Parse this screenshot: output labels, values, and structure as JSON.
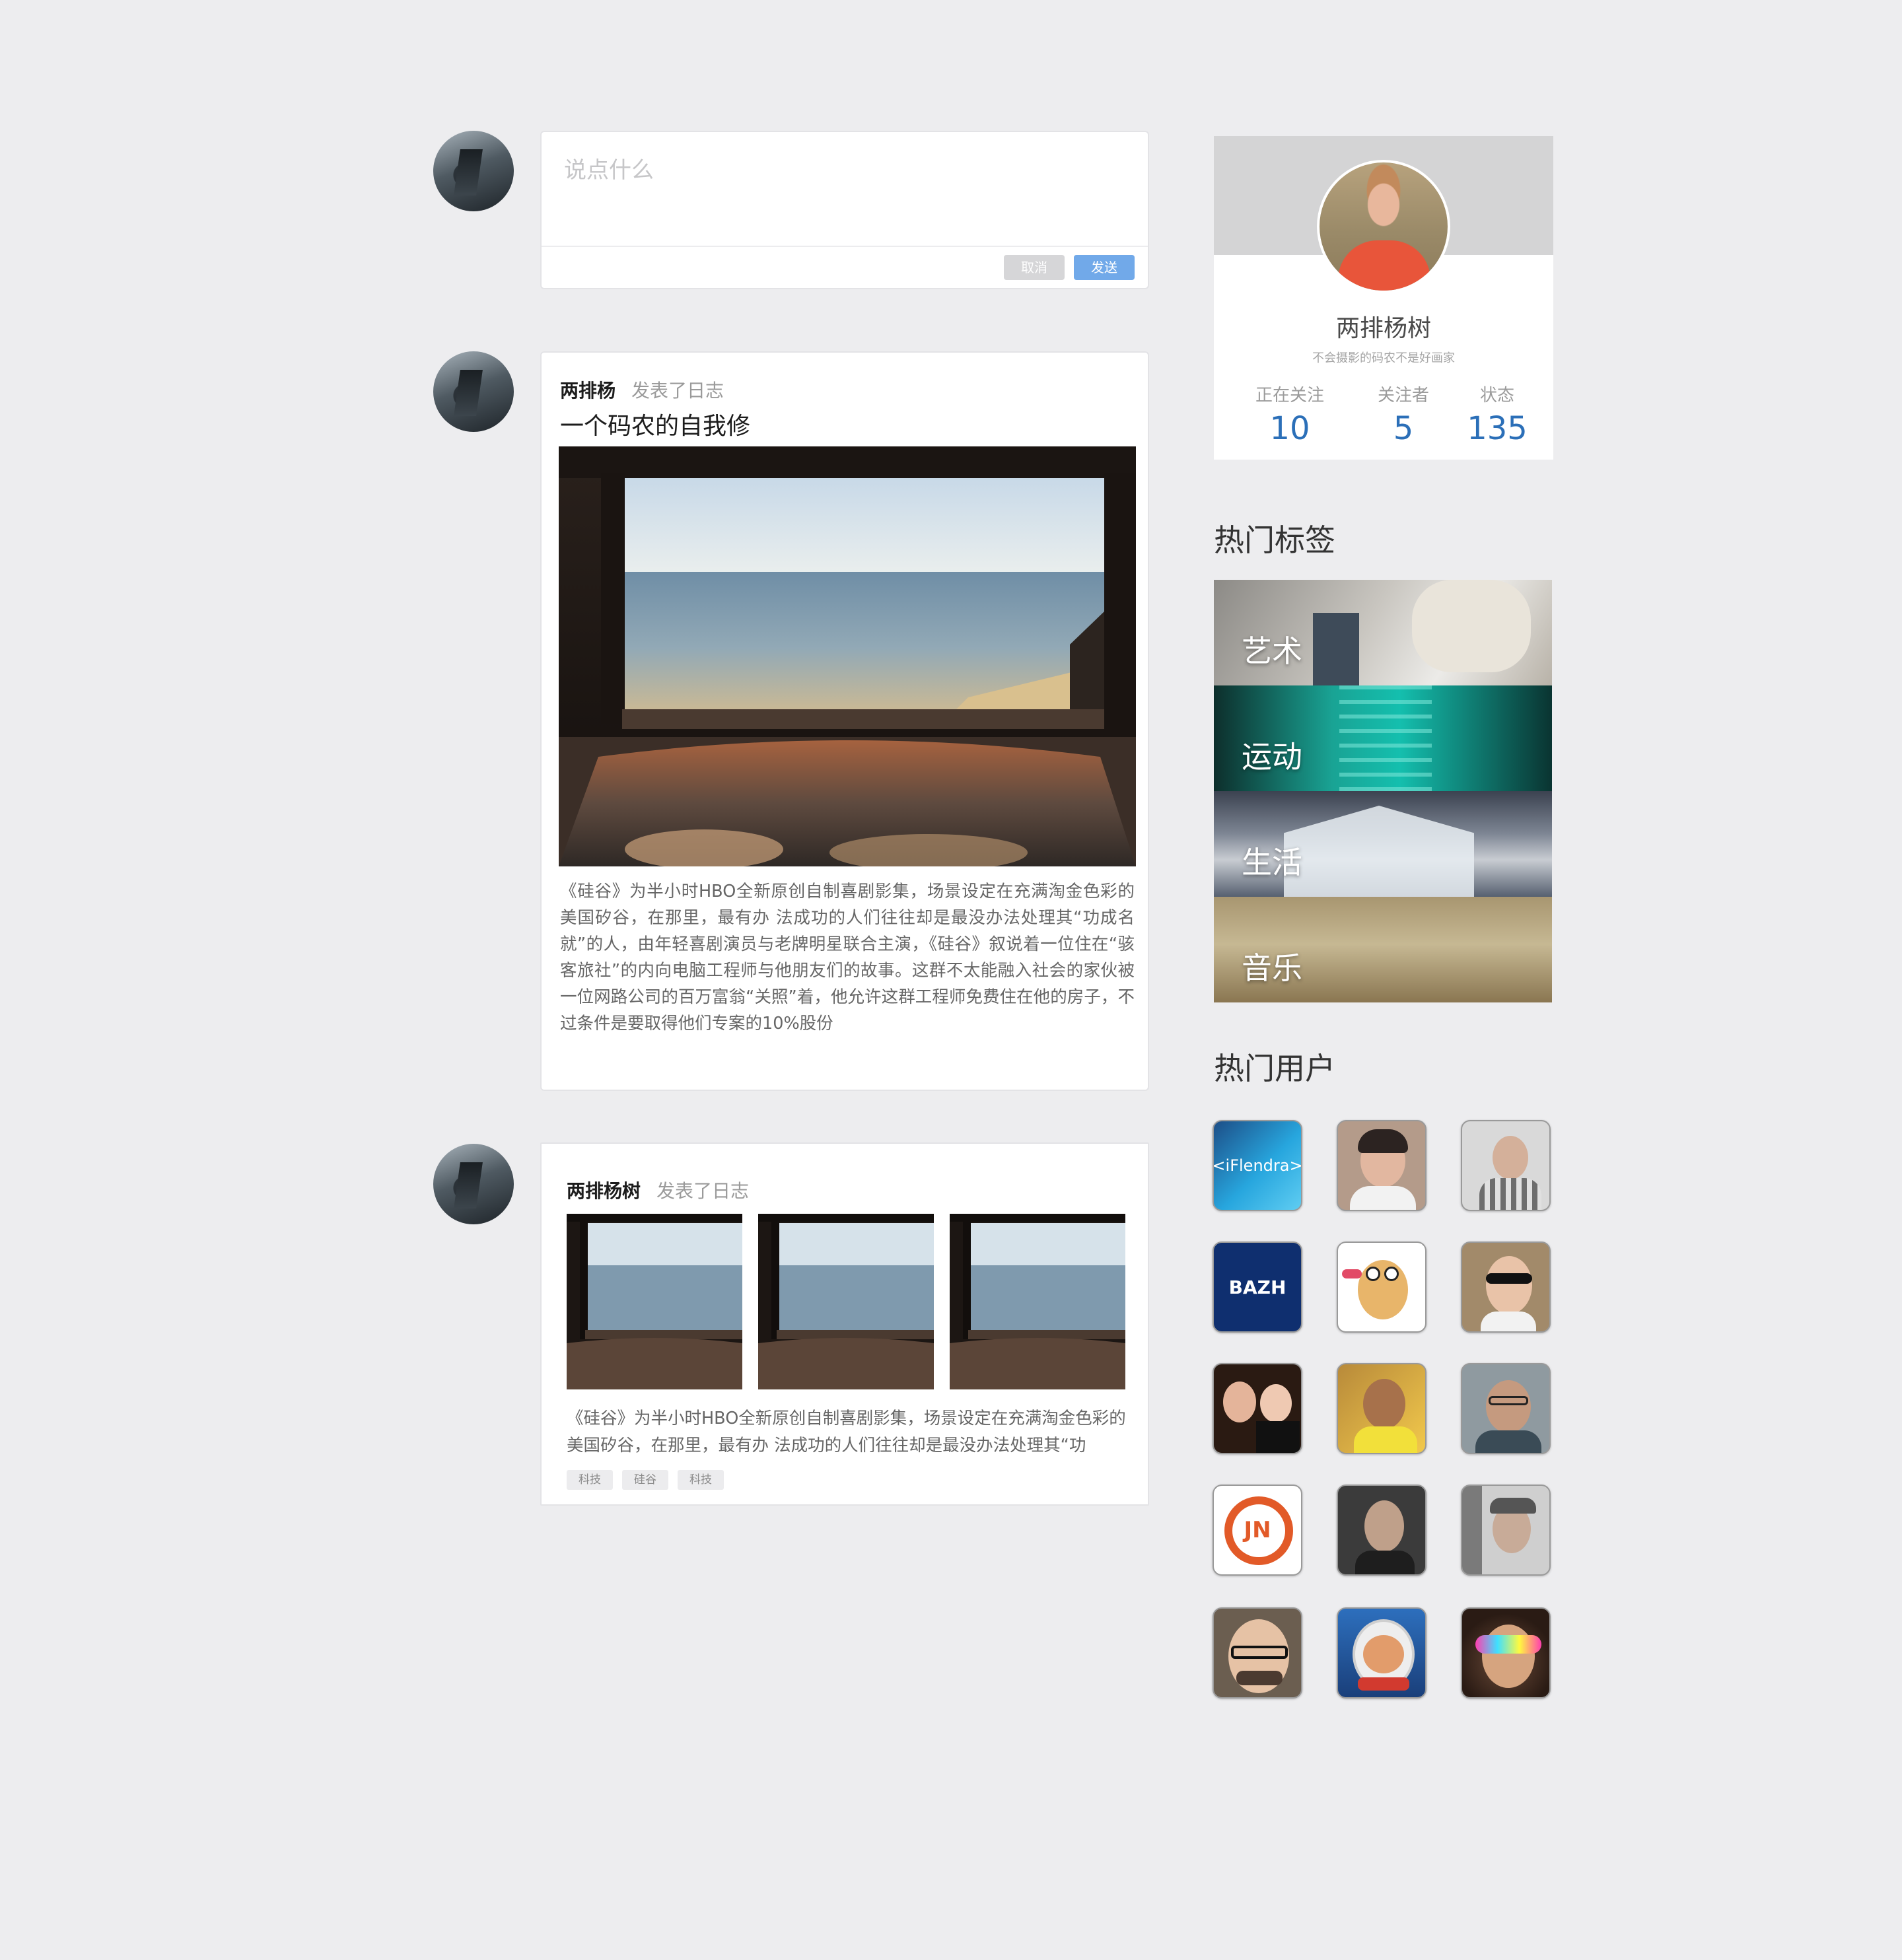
{
  "composer": {
    "placeholder": "说点什么",
    "cancel_label": "取消",
    "send_label": "发送"
  },
  "posts": [
    {
      "author": "两排杨",
      "action": "发表了日志",
      "title": "一个码农的自我修",
      "image": "bedroom-ocean-view-photo",
      "body": "《硅谷》为半小时HBO全新原创自制喜剧影集，场景设定在充满淘金色彩的美国矽谷，在那里，最有办  法成功的人们往往却是最没办法处理其“功成名就”的人，由年轻喜剧演员与老牌明星联合主演，《硅谷》叙说着一位住在“骇客旅社”的内向电脑工程师与他朋友们的故事。这群不太能融入社会的家伙被一位网路公司的百万富翁“关照”着，他允许这群工程师免费住在他的房子，不过条件是要取得他们专案的10%股份"
    },
    {
      "author": "两排杨树",
      "action": "发表了日志",
      "images": [
        "bedroom-ocean-view-photo",
        "bedroom-ocean-view-photo",
        "bedroom-ocean-view-photo"
      ],
      "body": "《硅谷》为半小时HBO全新原创自制喜剧影集，场景设定在充满淘金色彩的美国矽谷，在那里，最有办  法成功的人们往往却是最没办法处理其“功",
      "tags": [
        "科技",
        "硅谷",
        "科技"
      ]
    }
  ],
  "profile": {
    "name": "两排杨树",
    "bio": "不会摄影的码农不是好画家",
    "stats": [
      {
        "label": "正在关注",
        "value": "10"
      },
      {
        "label": "关注者",
        "value": "5"
      },
      {
        "label": "状态",
        "value": "135"
      }
    ]
  },
  "hot_tags": {
    "heading": "热门标签",
    "items": [
      "艺术",
      "运动",
      "生活",
      "音乐"
    ]
  },
  "hot_users": {
    "heading": "热门用户",
    "badges": {
      "iflendra": "<iFlendra>",
      "bazh": "BAZH",
      "jn": "JN"
    }
  },
  "colors": {
    "background": "#ededef",
    "send_button": "#71a9e9",
    "cancel_button": "#d6d6d8",
    "stat_number": "#2b6fb8"
  }
}
